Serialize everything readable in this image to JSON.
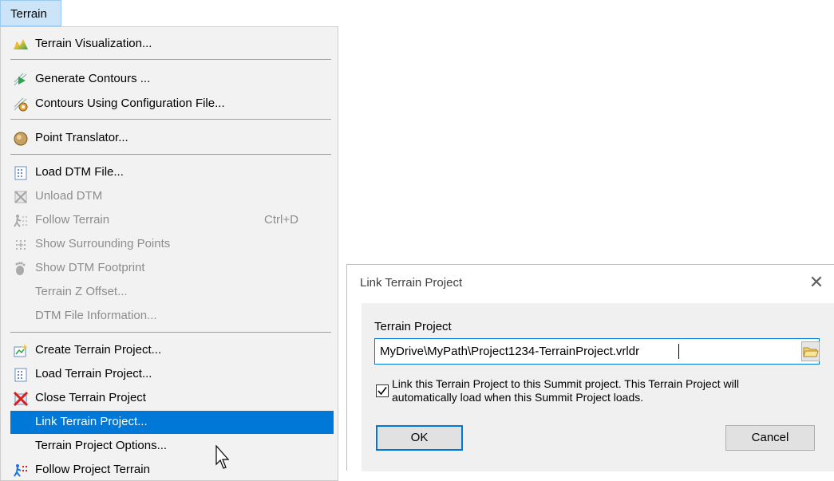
{
  "menubar": {
    "title": "Terrain"
  },
  "menu": {
    "items": [
      {
        "label": "Terrain Visualization...",
        "icon": "terrain-visualization-icon",
        "enabled": true
      },
      {
        "label": "Generate Contours ...",
        "icon": "generate-contours-icon",
        "enabled": true
      },
      {
        "label": "Contours Using Configuration File...",
        "icon": "contours-config-icon",
        "enabled": true
      },
      {
        "label": "Point Translator...",
        "icon": "point-translator-icon",
        "enabled": true
      },
      {
        "label": "Load DTM File...",
        "icon": "load-dtm-icon",
        "enabled": true
      },
      {
        "label": "Unload DTM",
        "icon": "unload-dtm-icon",
        "enabled": false
      },
      {
        "label": "Follow Terrain",
        "shortcut": "Ctrl+D",
        "icon": "follow-terrain-icon",
        "enabled": false
      },
      {
        "label": "Show Surrounding Points",
        "icon": "surrounding-points-icon",
        "enabled": false
      },
      {
        "label": "Show DTM Footprint",
        "icon": "footprint-icon",
        "enabled": false
      },
      {
        "label": "Terrain Z Offset...",
        "enabled": false
      },
      {
        "label": "DTM File Information...",
        "enabled": false
      },
      {
        "label": "Create Terrain Project...",
        "icon": "create-terrain-project-icon",
        "enabled": true
      },
      {
        "label": "Load Terrain Project...",
        "icon": "load-terrain-project-icon",
        "enabled": true
      },
      {
        "label": "Close Terrain Project",
        "icon": "close-terrain-project-icon",
        "enabled": true
      },
      {
        "label": "Link Terrain Project...",
        "enabled": true,
        "selected": true
      },
      {
        "label": "Terrain Project Options...",
        "enabled": true
      },
      {
        "label": "Follow Project Terrain",
        "icon": "follow-project-terrain-icon",
        "enabled": true
      }
    ]
  },
  "dialog": {
    "title": "Link Terrain Project",
    "field_label": "Terrain Project",
    "path_value": "MyDrive\\MyPath\\Project1234-TerrainProject.vrldr",
    "checkbox_checked": true,
    "checkbox_label": "Link this Terrain Project to this Summit project.  This Terrain Project will automatically load when this Summit Project loads.",
    "ok_label": "OK",
    "cancel_label": "Cancel"
  },
  "colors": {
    "selection": "#0078d7",
    "menu_bg": "#f2f2f2",
    "dialog_body": "#f0f0f0"
  }
}
